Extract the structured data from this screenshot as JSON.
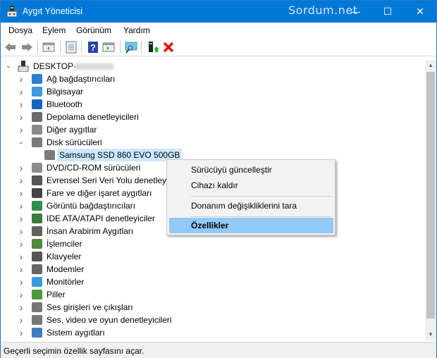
{
  "window": {
    "title": "Aygıt Yöneticisi",
    "watermark": "Sordum.net",
    "minimize": "—",
    "maximize": "☐",
    "close": "✕"
  },
  "menu": [
    "Dosya",
    "Eylem",
    "Görünüm",
    "Yardım"
  ],
  "toolbar": [
    "back",
    "forward",
    "show-hide-console-tree",
    "properties",
    "help",
    "show-action-pane",
    "scan-hardware",
    "update-driver",
    "uninstall"
  ],
  "tree": {
    "root": "DESKTOP-",
    "items": [
      {
        "label": "Ağ bağdaştırıcıları",
        "color": "#2a7fd4",
        "expanded": false
      },
      {
        "label": "Bilgisayar",
        "color": "#3c9be0",
        "expanded": false
      },
      {
        "label": "Bluetooth",
        "color": "#1565c0",
        "expanded": false
      },
      {
        "label": "Depolama denetleyicileri",
        "color": "#6b6b6b",
        "expanded": false
      },
      {
        "label": "Diğer aygıtlar",
        "color": "#8a8a8a",
        "expanded": false
      },
      {
        "label": "Disk sürücüleri",
        "color": "#7a7a7a",
        "expanded": true
      },
      {
        "label": "Samsung SSD 860 EVO 500GB",
        "color": "#7a7a7a",
        "child": true,
        "selected": true
      },
      {
        "label": "DVD/CD-ROM sürücüleri",
        "color": "#8c8c8c",
        "expanded": false
      },
      {
        "label": "Evrensel Seri Veri Yolu denetleyic",
        "color": "#555555",
        "expanded": false
      },
      {
        "label": "Fare ve diğer işaret aygıtları",
        "color": "#444444",
        "expanded": false
      },
      {
        "label": "Görüntü bağdaştırıcıları",
        "color": "#2f8f4f",
        "expanded": false
      },
      {
        "label": "IDE ATA/ATAPI denetleyiciler",
        "color": "#3a7d3a",
        "expanded": false
      },
      {
        "label": "İnsan Arabirim Aygıtları",
        "color": "#606060",
        "expanded": false
      },
      {
        "label": "İşlemciler",
        "color": "#4f8a3a",
        "expanded": false
      },
      {
        "label": "Klavyeler",
        "color": "#555555",
        "expanded": false
      },
      {
        "label": "Modemler",
        "color": "#666666",
        "expanded": false
      },
      {
        "label": "Monitörler",
        "color": "#3c9be0",
        "expanded": false
      },
      {
        "label": "Piller",
        "color": "#4a9a3a",
        "expanded": false
      },
      {
        "label": "Ses girişleri ve çıkışları",
        "color": "#777777",
        "expanded": false
      },
      {
        "label": "Ses, video ve oyun denetleyicileri",
        "color": "#777777",
        "expanded": false
      },
      {
        "label": "Sistem aygıtları",
        "color": "#3c7fc0",
        "expanded": false
      }
    ]
  },
  "context_menu": {
    "items": [
      "Sürücüyü güncelleştir",
      "Cihazı kaldır",
      "Donanım değişikliklerini tara",
      "Özellikler"
    ],
    "highlighted": "Özellikler"
  },
  "status": "Geçerli seçimin özellik sayfasını açar."
}
